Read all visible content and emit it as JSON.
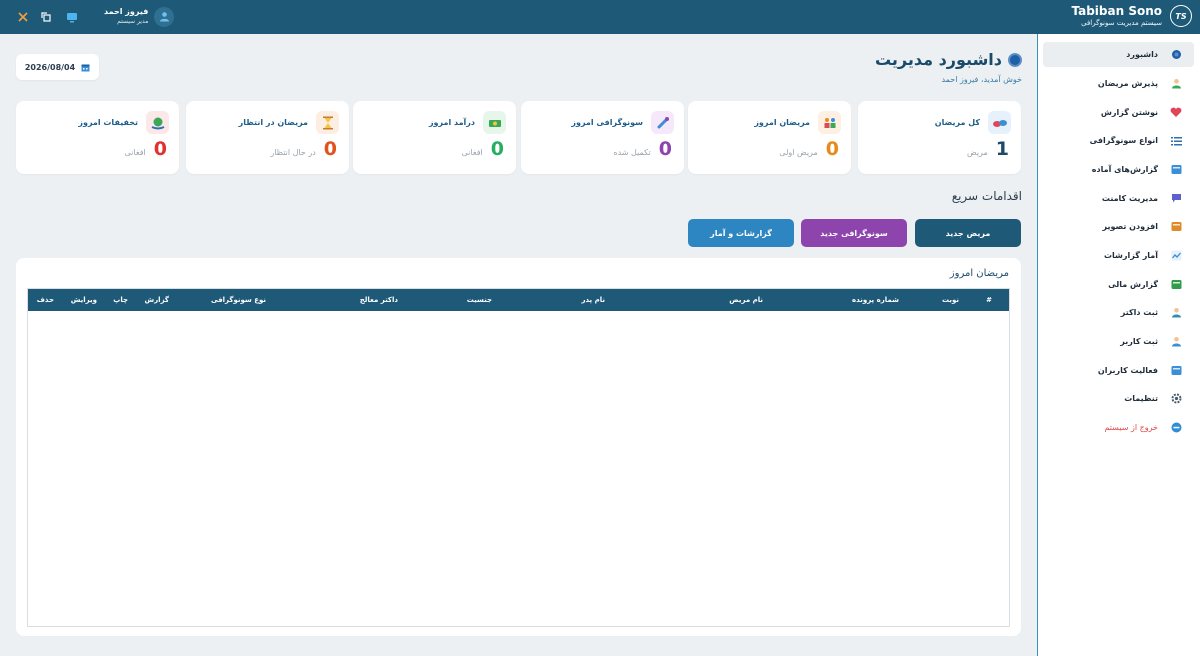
{
  "header": {
    "brand_title": "Tabiban Sono",
    "brand_subtitle": "سیستم مدیریت سونوگرافی",
    "logo_text": "TS",
    "user_name": "فیروز احمد",
    "user_role": "مدیر سیستم",
    "icons": [
      "close-icon",
      "copy-icon",
      "monitor-icon",
      "user-icon"
    ]
  },
  "sidebar": {
    "items": [
      {
        "label": "داشبورد",
        "icon": "dashboard-icon",
        "color": "#1d5fa8",
        "active": true
      },
      {
        "label": "پذیرش مریضان",
        "icon": "patient-add-icon",
        "color": "#3aa857"
      },
      {
        "label": "نوشتن گزارش",
        "icon": "heartbeat-icon",
        "color": "#e0465a"
      },
      {
        "label": "انواع سونوگرافی",
        "icon": "list-icon",
        "color": "#2f6fb3"
      },
      {
        "label": "گزارش‌های آماده",
        "icon": "window-icon",
        "color": "#3a8fd6"
      },
      {
        "label": "مدیریت کامنت",
        "icon": "comment-icon",
        "color": "#5b62c9"
      },
      {
        "label": "افزودن تصویر",
        "icon": "image-icon",
        "color": "#e08a2a"
      },
      {
        "label": "آمار گزارشات",
        "icon": "chart-icon",
        "color": "#3a8fd6"
      },
      {
        "label": "گزارش مالی",
        "icon": "money-bag-icon",
        "color": "#2e9c4a"
      },
      {
        "label": "ثبت داکتر",
        "icon": "doctor-icon",
        "color": "#2f8fb3"
      },
      {
        "label": "ثبت کاربر",
        "icon": "user-add-icon",
        "color": "#3a8fd6"
      },
      {
        "label": "فعالیت کاربران",
        "icon": "activity-icon",
        "color": "#3a8fd6"
      },
      {
        "label": "تنظیمات",
        "icon": "gear-icon",
        "color": "#4a5a68"
      },
      {
        "label": "خروج از سیستم",
        "icon": "logout-icon",
        "color": "#2f8fd6"
      }
    ]
  },
  "main": {
    "title": "داشبورد مدیریت",
    "welcome": "خوش آمدید، فیروز احمد",
    "date": "2026/08/04",
    "stats": [
      {
        "title": "کل مریضان",
        "value": "1",
        "unit": "مریض",
        "color": "#1e4a6a",
        "icon": "pills-icon",
        "bg": "#e6f1fb"
      },
      {
        "title": "مریضان امروز",
        "value": "0",
        "unit": "مریض اولی",
        "color": "#e88a1a",
        "icon": "people-icon",
        "bg": "#fdf0e3"
      },
      {
        "title": "سونوگرافی امروز",
        "value": "0",
        "unit": "تکمیل شده",
        "color": "#8e44ad",
        "icon": "probe-icon",
        "bg": "#f4e8fa"
      },
      {
        "title": "درآمد امروز",
        "value": "0",
        "unit": "افغانی",
        "color": "#27ae60",
        "icon": "cash-icon",
        "bg": "#e6f6ea"
      },
      {
        "title": "مریضان در انتظار",
        "value": "0",
        "unit": "در حال انتظار",
        "color": "#e0531f",
        "icon": "hourglass-icon",
        "bg": "#fdeee3"
      },
      {
        "title": "تخفیفات امروز",
        "value": "0",
        "unit": "افغانی",
        "color": "#e0322f",
        "icon": "discount-icon",
        "bg": "#fde8e8"
      }
    ],
    "quick_title": "اقدامات سریع",
    "quick_actions": [
      {
        "label": "مریض جدید",
        "color": "#1e5a78"
      },
      {
        "label": "سونوگرافی جدید",
        "color": "#8e44ad"
      },
      {
        "label": "گزارشات و آمار",
        "color": "#2d86c1"
      }
    ],
    "table": {
      "title": "مریضان امروز",
      "columns": [
        "#",
        "نوبت",
        "شماره پرونده",
        "نام مریض",
        "نام پدر",
        "جنسیت",
        "داکتر معالج",
        "نوع سونوگرافی",
        "گزارش",
        "چاپ",
        "ویرایش",
        "حذف"
      ],
      "rows": []
    }
  }
}
